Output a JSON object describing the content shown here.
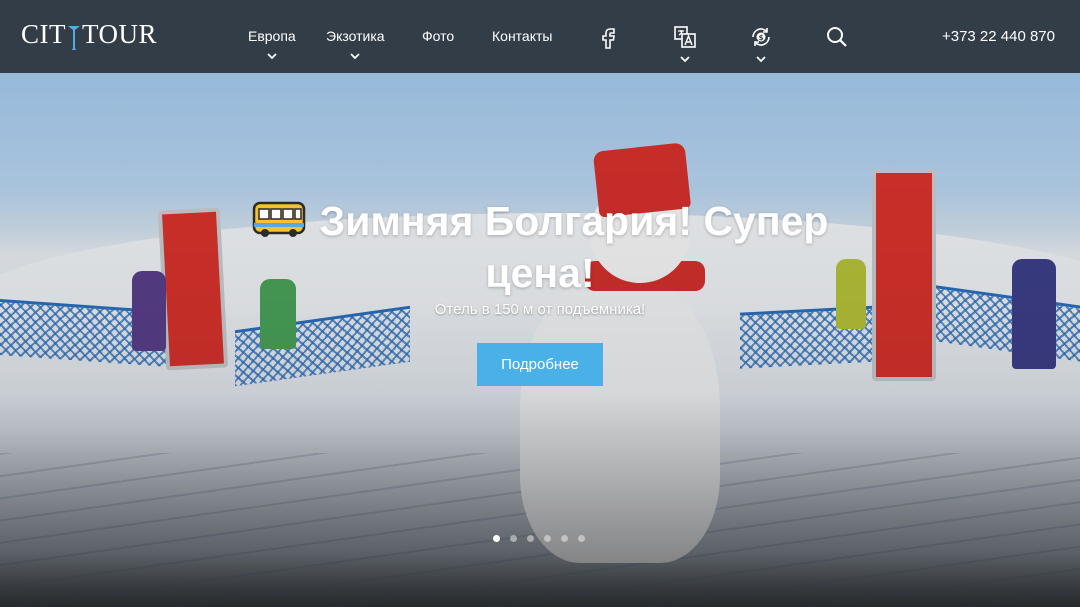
{
  "header": {
    "logo_text_left": "CIT",
    "logo_text_right": "TOUR",
    "logo_full": "CITYTOUR",
    "nav": [
      {
        "label": "Европа",
        "has_dropdown": true
      },
      {
        "label": "Экзотика",
        "has_dropdown": true
      },
      {
        "label": "Фото",
        "has_dropdown": false
      },
      {
        "label": "Контакты",
        "has_dropdown": false
      }
    ],
    "icons": [
      {
        "name": "facebook-icon",
        "has_dropdown": false
      },
      {
        "name": "translate-icon",
        "has_dropdown": true
      },
      {
        "name": "currency-icon",
        "has_dropdown": true
      },
      {
        "name": "search-icon",
        "has_dropdown": false
      }
    ],
    "phone": "+373 22 440 870"
  },
  "hero": {
    "title": "Зимняя Болгария! Супер цена!",
    "title_icon": "bus-icon",
    "subtitle": "Отель в 150 м от подъемника!",
    "button_label": "Подробнее",
    "slide_count": 6,
    "active_slide": 1
  },
  "colors": {
    "header_bg": "#333d47",
    "accent": "#4ab1e8",
    "banner_red": "#d9322c",
    "net_blue": "#2a6fc0"
  }
}
